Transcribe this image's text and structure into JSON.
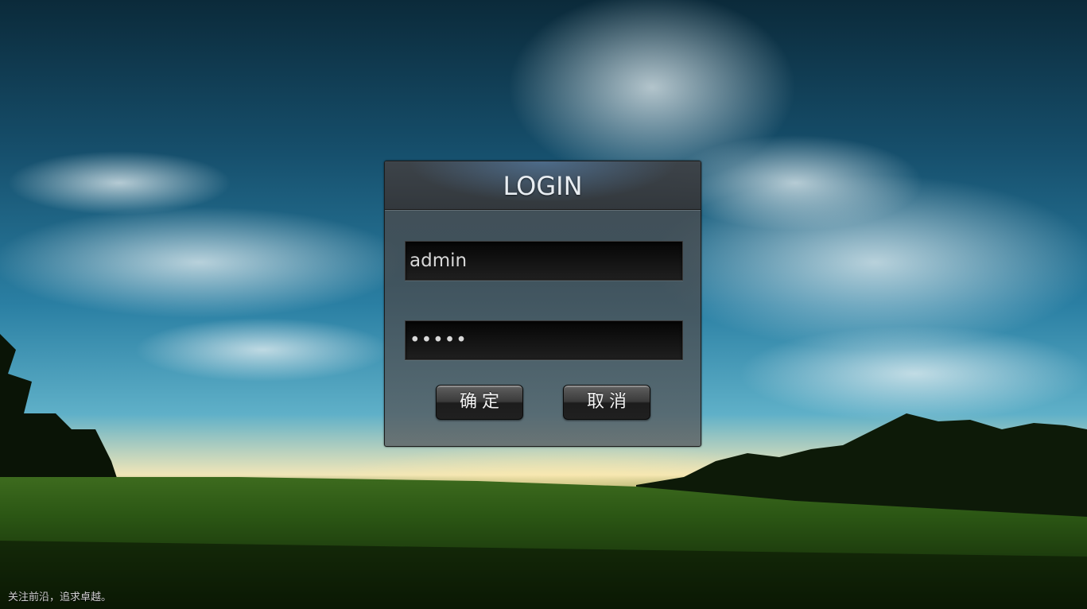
{
  "login": {
    "title": "LOGIN",
    "username_value": "admin",
    "password_value": "•••••",
    "confirm_label": "确定",
    "cancel_label": "取消"
  },
  "footer": {
    "text": "关注前沿，追求卓越。"
  },
  "colors": {
    "panel_bg": "#4a4e52",
    "field_bg": "#0f0f0f",
    "title_text": "#e8edf2",
    "button_text": "#f2f2f2"
  }
}
